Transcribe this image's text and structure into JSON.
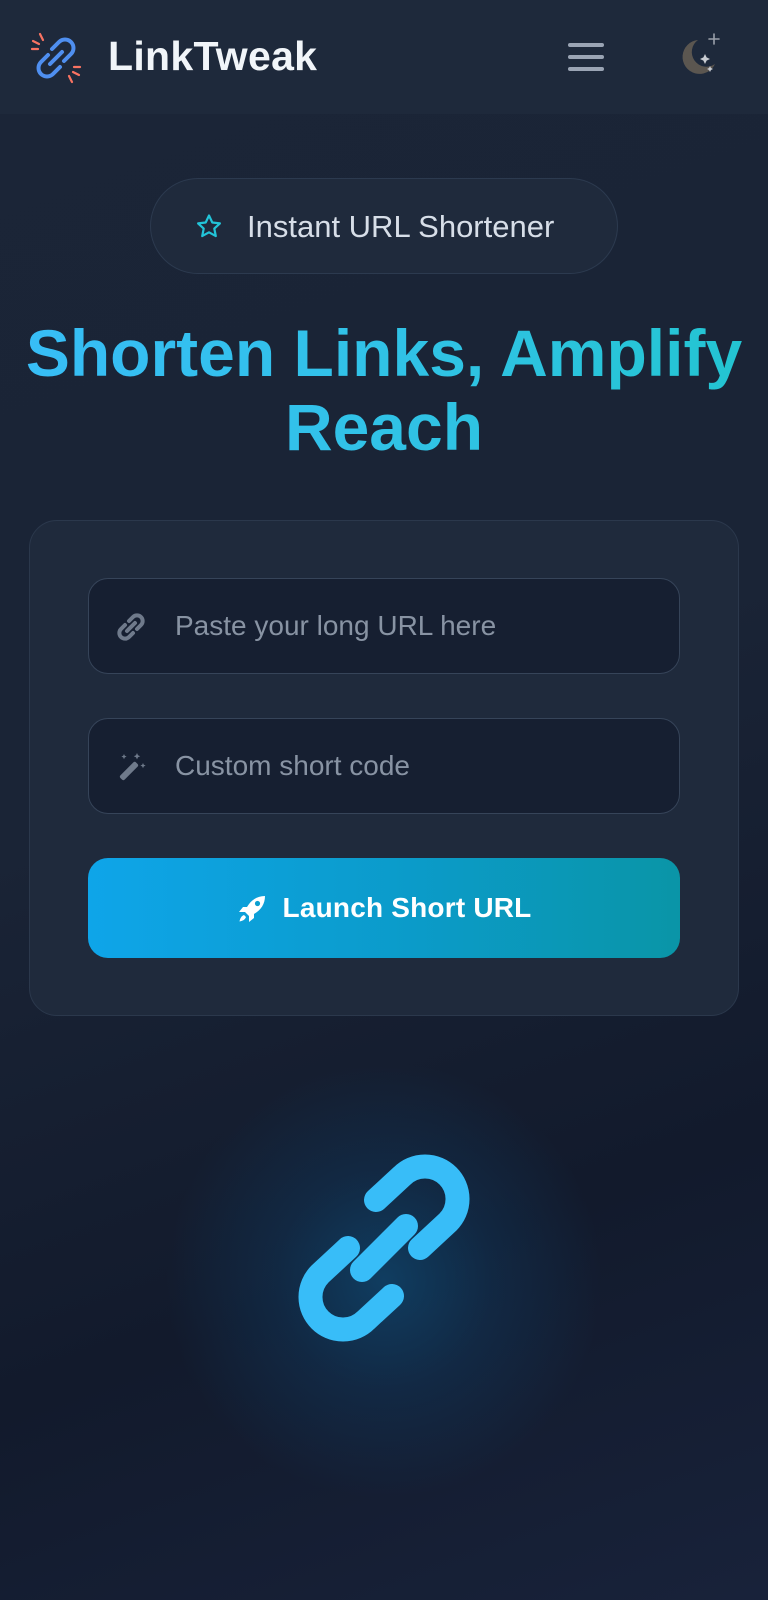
{
  "header": {
    "brand": "LinkTweak",
    "logo_icon": "link-broken-icon",
    "menu_icon": "hamburger-menu-icon",
    "theme_icon": "moon-stars-icon"
  },
  "badge": {
    "icon": "star-outline-icon",
    "label": "Instant URL Shortener"
  },
  "hero": {
    "title": "Shorten Links, Amplify Reach"
  },
  "form": {
    "url_field": {
      "icon": "link-icon",
      "placeholder": "Paste your long URL here",
      "value": ""
    },
    "code_field": {
      "icon": "magic-wand-icon",
      "placeholder": "Custom short code",
      "value": ""
    },
    "submit": {
      "icon": "rocket-icon",
      "label": "Launch Short URL"
    }
  },
  "illustration": {
    "icon": "link-icon"
  },
  "colors": {
    "background": "#1a2436",
    "header": "#1e293b",
    "card": "#1f2a3c",
    "accent": "#38bdf8",
    "button_start": "#0ea5e9",
    "button_end": "#0a95a7"
  }
}
